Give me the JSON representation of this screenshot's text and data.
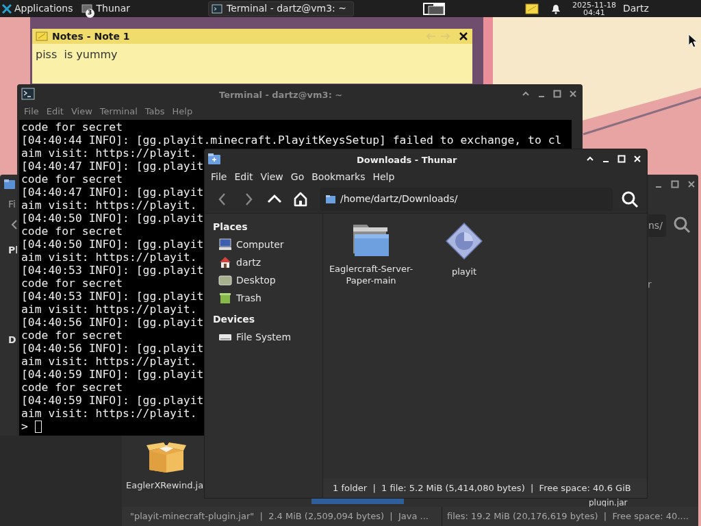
{
  "panel": {
    "apps_label": "Applications",
    "tasks": [
      {
        "kind": "thunar",
        "label": "Thunar",
        "badge": "3",
        "selected": false
      },
      {
        "kind": "terminal",
        "label": "Terminal - dartz@vm3: ~",
        "selected": true
      }
    ],
    "clock": {
      "date": "2025-11-18",
      "time": "04:41"
    },
    "user": "Dartz"
  },
  "notes": {
    "title": "Notes - Note 1",
    "body": "piss  is yummy"
  },
  "terminal": {
    "title": "Terminal - dartz@vm3: ~",
    "menu": [
      "File",
      "Edit",
      "View",
      "Terminal",
      "Tabs",
      "Help"
    ],
    "lines": [
      "code for secret",
      "[04:40:44 INFO]: [gg.playit.minecraft.PlayitKeysSetup] failed to exchange, to cl",
      "aim visit: https://playit.",
      "[04:40:47 INFO]: [gg.playit",
      "code for secret",
      "[04:40:47 INFO]: [gg.playit",
      "aim visit: https://playit.",
      "[04:40:50 INFO]: [gg.playit",
      "code for secret",
      "[04:40:50 INFO]: [gg.playit",
      "aim visit: https://playit.",
      "[04:40:53 INFO]: [gg.playit",
      "code for secret",
      "[04:40:53 INFO]: [gg.playit",
      "aim visit: https://playit.",
      "[04:40:56 INFO]: [gg.playit",
      "code for secret",
      "[04:40:56 INFO]: [gg.playit",
      "aim visit: https://playit.",
      "[04:40:59 INFO]: [gg.playit",
      "code for secret",
      "[04:40:59 INFO]: [gg.playit",
      "aim visit: https://playit."
    ],
    "prompt": ">"
  },
  "thunar": {
    "title": "Downloads - Thunar",
    "menu": [
      "File",
      "Edit",
      "View",
      "Go",
      "Bookmarks",
      "Help"
    ],
    "toolbar": [
      {
        "kind": "back",
        "disabled": true
      },
      {
        "kind": "forward",
        "disabled": true
      },
      {
        "kind": "up",
        "disabled": false
      },
      {
        "kind": "home",
        "disabled": false
      }
    ],
    "path": "/home/dartz/Downloads/",
    "sidebar": [
      {
        "heading": "Places",
        "items": [
          {
            "kind": "computer",
            "label": "Computer"
          },
          {
            "kind": "home",
            "label": "dartz"
          },
          {
            "kind": "desktop",
            "label": "Desktop"
          },
          {
            "kind": "trash",
            "label": "Trash"
          }
        ]
      },
      {
        "heading": "Devices",
        "items": [
          {
            "kind": "drive",
            "label": "File System"
          }
        ]
      }
    ],
    "files": [
      {
        "kind": "folder",
        "label": "Eaglercraft-Server-Paper-main"
      },
      {
        "kind": "executable",
        "label": "playit"
      }
    ],
    "status": "1 folder  |  1 file: 5.2 MiB (5,414,080 bytes)  |  Free space: 40.6 GiB"
  },
  "background_window": {
    "menu_fragment": "Fi",
    "places_fragment": "Pl",
    "devices_fragment": "D",
    "path_fragment": "ns/",
    "item_fragment": "r",
    "file_label": "EaglerXRewind.ja",
    "other_file_label": "plugin.jar",
    "status_left": "\"playit-minecraft-plugin.jar\"  |  2.4 MiB (2,509,094 bytes)  |  Java ...",
    "status_right": "files: 19.2 MiB (20,176,619 bytes)  |  Free space: 40...."
  }
}
